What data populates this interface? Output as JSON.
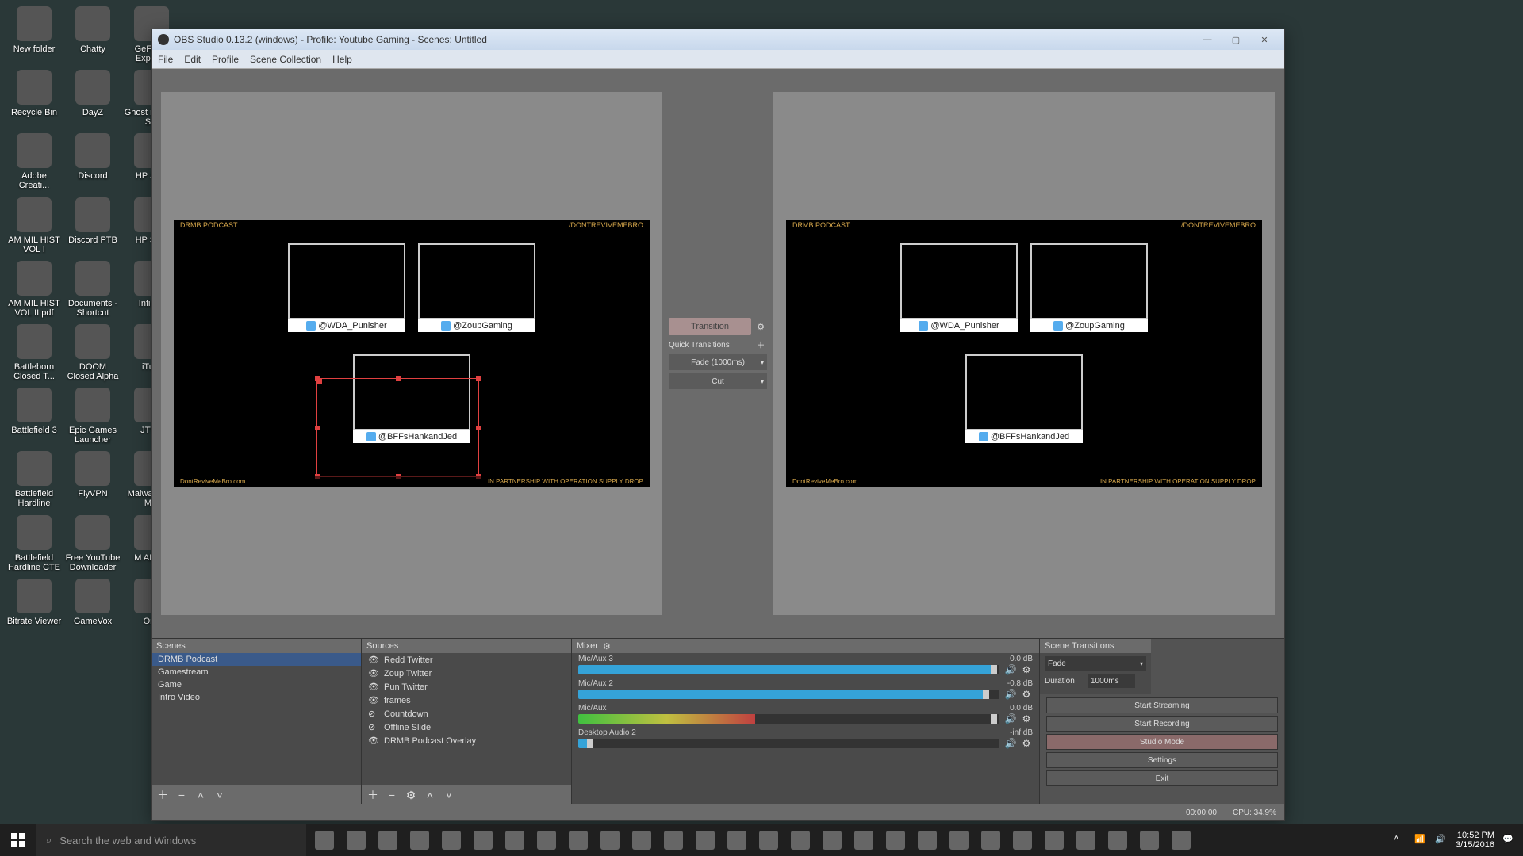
{
  "desktop": {
    "icons": [
      {
        "label": "New folder"
      },
      {
        "label": "Chatty"
      },
      {
        "label": "GeForce Experi..."
      },
      {
        "label": "Recycle Bin"
      },
      {
        "label": "DayZ"
      },
      {
        "label": "Ghost in Shell S..."
      },
      {
        "label": "Adobe Creati..."
      },
      {
        "label": "Discord"
      },
      {
        "label": "HP Sc..."
      },
      {
        "label": "AM MIL HIST VOL I"
      },
      {
        "label": "Discord PTB"
      },
      {
        "label": "HP Su..."
      },
      {
        "label": "AM MIL HIST VOL II pdf"
      },
      {
        "label": "Documents - Shortcut"
      },
      {
        "label": "Infini..."
      },
      {
        "label": "Battleborn Closed T..."
      },
      {
        "label": "DOOM Closed Alpha"
      },
      {
        "label": "iTu..."
      },
      {
        "label": "Battlefield 3"
      },
      {
        "label": "Epic Games Launcher"
      },
      {
        "label": "JTV..."
      },
      {
        "label": "Battlefield Hardline"
      },
      {
        "label": "FlyVPN"
      },
      {
        "label": "Malwar Anti-M..."
      },
      {
        "label": "Battlefield Hardline CTE"
      },
      {
        "label": "Free YouTube Downloader"
      },
      {
        "label": "M After..."
      },
      {
        "label": "Bitrate Viewer"
      },
      {
        "label": "GameVox"
      },
      {
        "label": "Or..."
      }
    ]
  },
  "obs": {
    "title": "OBS Studio 0.13.2 (windows) - Profile: Youtube Gaming - Scenes: Untitled",
    "menu": [
      "File",
      "Edit",
      "Profile",
      "Scene Collection",
      "Help"
    ],
    "transition": {
      "button": "Transition",
      "quick_label": "Quick Transitions",
      "options": [
        "Fade (1000ms)",
        "Cut"
      ]
    },
    "overlay": {
      "brand": "DRMB PODCAST",
      "social": "/DONTREVIVEMEBRO",
      "site": "DontReviveMeBro.com",
      "partner": "IN PARTNERSHIP WITH  OPERATION SUPPLY DROP",
      "cams": [
        {
          "handle": "@WDA_Punisher"
        },
        {
          "handle": "@ZoupGaming"
        },
        {
          "handle": "@BFFsHankandJed"
        }
      ]
    },
    "scenes": {
      "header": "Scenes",
      "items": [
        "DRMB Podcast",
        "Gamestream",
        "Game",
        "Intro Video"
      ],
      "selected": 0
    },
    "sources": {
      "header": "Sources",
      "items": [
        {
          "name": "Redd Twitter",
          "visible": true
        },
        {
          "name": "Zoup Twitter",
          "visible": true
        },
        {
          "name": "Pun Twitter",
          "visible": true
        },
        {
          "name": "frames",
          "visible": true
        },
        {
          "name": "Countdown",
          "visible": false
        },
        {
          "name": "Offline Slide",
          "visible": false
        },
        {
          "name": "DRMB Podcast Overlay",
          "visible": true
        }
      ]
    },
    "mixer": {
      "header": "Mixer",
      "channels": [
        {
          "name": "Mic/Aux 3",
          "db": "0.0 dB",
          "fill": 98,
          "knob": 98
        },
        {
          "name": "Mic/Aux 2",
          "db": "-0.8 dB",
          "fill": 96,
          "knob": 96
        },
        {
          "name": "Mic/Aux",
          "db": "0.0 dB",
          "fill": 42,
          "knob": 98,
          "green": true
        },
        {
          "name": "Desktop Audio 2",
          "db": "-inf dB",
          "fill": 2,
          "knob": 2
        }
      ]
    },
    "scene_transitions": {
      "header": "Scene Transitions",
      "type": "Fade",
      "duration_label": "Duration",
      "duration": "1000ms"
    },
    "controls": {
      "buttons": [
        "Start Streaming",
        "Start Recording",
        "Studio Mode",
        "Settings",
        "Exit"
      ],
      "active_idx": 2
    },
    "status": {
      "time": "00:00:00",
      "cpu": "CPU: 34.9%"
    }
  },
  "taskbar": {
    "search_placeholder": "Search the web and Windows",
    "time": "10:52 PM",
    "date": "3/15/2016"
  }
}
